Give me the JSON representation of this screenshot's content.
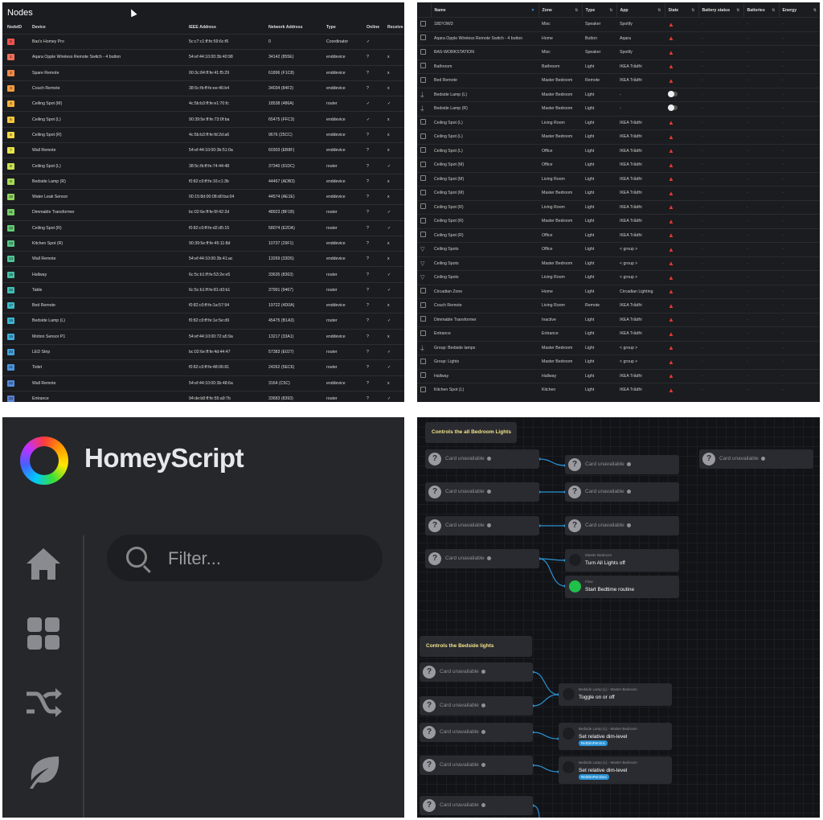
{
  "nodes": {
    "title": "Nodes",
    "headers": [
      "NodeID",
      "Device",
      "IEEE Address",
      "Network Address",
      "Type",
      "Online",
      "Receive"
    ],
    "rows": [
      {
        "id": "X",
        "color": "#ef5350",
        "device": "Bas's Homey Pro",
        "ieee": "5c:c7:c1:ff:fe:59:6c:f6",
        "net": "0",
        "type": "Coordinator",
        "online": "✓",
        "receive": ""
      },
      {
        "id": "1",
        "color": "#ef6f5a",
        "device": "Aqara Opple Wireless Remote Switch - 4 button",
        "ieee": "54:ef:44:10:00:3b:40:98",
        "net": "34142 (855E)",
        "type": "enddevice",
        "online": "?",
        "receive": "x"
      },
      {
        "id": "2",
        "color": "#f08a48",
        "device": "Spare Remote",
        "ieee": "00:3c:84:ff:fe:41:f5:29",
        "net": "61896 (F1C8)",
        "type": "enddevice",
        "online": "?",
        "receive": "x"
      },
      {
        "id": "3",
        "color": "#f39c3c",
        "device": "Couch Remote",
        "ieee": "38:5c:fb:ff:fe:ee:46:b4",
        "net": "34034 (84F2)",
        "type": "enddevice",
        "online": "?",
        "receive": "x"
      },
      {
        "id": "4",
        "color": "#f6b23a",
        "device": "Ceiling Spot (M)",
        "ieee": "4c:5b:b3:ff:fe:e1:70:fc",
        "net": "18538 (486A)",
        "type": "router",
        "online": "✓",
        "receive": "✓"
      },
      {
        "id": "5",
        "color": "#f7c73c",
        "device": "Ceiling Spot (L)",
        "ieee": "90:39:5e:ff:fe:73:0f:ba",
        "net": "65475 (FFC3)",
        "type": "enddevice",
        "online": "✓",
        "receive": "x"
      },
      {
        "id": "6",
        "color": "#f4d940",
        "device": "Ceiling Spot (R)",
        "ieee": "4c:5b:b3:ff:fe:fd:2d:a6",
        "net": "9676 (25CC)",
        "type": "enddevice",
        "online": "?",
        "receive": "x"
      },
      {
        "id": "7",
        "color": "#e8e54a",
        "device": "Wall Remote",
        "ieee": "54:ef:44:10:00:3b:51:0a",
        "net": "60303 (EB8F)",
        "type": "enddevice",
        "online": "?",
        "receive": "x"
      },
      {
        "id": "8",
        "color": "#c9e24f",
        "device": "Ceiling Spot (L)",
        "ieee": "38:5c:fb:ff:fe:74:44:48",
        "net": "37340 (91DC)",
        "type": "router",
        "online": "?",
        "receive": "✓"
      },
      {
        "id": "9",
        "color": "#a8dc55",
        "device": "Bedside Lamp (R)",
        "ieee": "f0:82:c0:ff:fe:16:c1:3b",
        "net": "44467 (ADB3)",
        "type": "enddevice",
        "online": "?",
        "receive": "x"
      },
      {
        "id": "10",
        "color": "#8fd65c",
        "device": "Water Leak Sensor",
        "ieee": "00:15:8d:00:08:d0:ba:04",
        "net": "44574 (AE1E)",
        "type": "enddevice",
        "online": "?",
        "receive": "x"
      },
      {
        "id": "11",
        "color": "#76d066",
        "device": "Dimmable Transformer",
        "ieee": "bc:02:6e:ff:fe:6f:42:2d",
        "net": "48923 (BF1B)",
        "type": "router",
        "online": "?",
        "receive": "✓"
      },
      {
        "id": "12",
        "color": "#62cb74",
        "device": "Ceiling Spot (R)",
        "ieee": "f0:82:c0:ff:fe:d2:d5:15",
        "net": "58074 (E2DA)",
        "type": "router",
        "online": "?",
        "receive": "✓"
      },
      {
        "id": "13",
        "color": "#56c786",
        "device": "Kitchen Spot (R)",
        "ieee": "90:39:5e:ff:fe:45:11:8d",
        "net": "10737 (29F1)",
        "type": "enddevice",
        "online": "?",
        "receive": "x"
      },
      {
        "id": "14",
        "color": "#4cc497",
        "device": "Wall Remote",
        "ieee": "54:ef:44:10:00:3b:41:ac",
        "net": "13269 (33D5)",
        "type": "enddevice",
        "online": "?",
        "receive": "x"
      },
      {
        "id": "15",
        "color": "#45c2a8",
        "device": "Hallway",
        "ieee": "6c:5c:b1:ff:fe:53:2e:e5",
        "net": "33635 (8363)",
        "type": "router",
        "online": "?",
        "receive": "✓"
      },
      {
        "id": "16",
        "color": "#40c0b8",
        "device": "Table",
        "ieee": "6c:5c:b1:ff:fe:81:d3:b1",
        "net": "37991 (9467)",
        "type": "router",
        "online": "?",
        "receive": "✓"
      },
      {
        "id": "17",
        "color": "#3dbdc8",
        "device": "Bed Remote",
        "ieee": "f0:82:c0:ff:fe:1a:57:94",
        "net": "19722 (4D0A)",
        "type": "enddevice",
        "online": "?",
        "receive": "x"
      },
      {
        "id": "18",
        "color": "#3cb7d4",
        "device": "Bedside Lamp (L)",
        "ieee": "f0:82:c0:ff:fe:1e:5e:d9",
        "net": "45475 (B1A3)",
        "type": "router",
        "online": "?",
        "receive": "✓"
      },
      {
        "id": "19",
        "color": "#3eaedc",
        "device": "Motion Sensor P1",
        "ieee": "54:ef:44:10:00:72:a5:9a",
        "net": "13217 (33A1)",
        "type": "enddevice",
        "online": "?",
        "receive": "x"
      },
      {
        "id": "20",
        "color": "#43a3e0",
        "device": "LED Strip",
        "ieee": "bc:02:6e:ff:fe:4d:44:47",
        "net": "57383 (E027)",
        "type": "router",
        "online": "?",
        "receive": "✓"
      },
      {
        "id": "21",
        "color": "#4a97e0",
        "device": "Toilet",
        "ieee": "f0:82:c0:ff:fe:48:06:81",
        "net": "24262 (5EC6)",
        "type": "router",
        "online": "?",
        "receive": "✓"
      },
      {
        "id": "22",
        "color": "#528bdc",
        "device": "Wall Remote",
        "ieee": "54:ef:44:10:00:3b:48:6a",
        "net": "3164 (C5C)",
        "type": "enddevice",
        "online": "?",
        "receive": "x"
      },
      {
        "id": "23",
        "color": "#5b80d6",
        "device": "Entrance",
        "ieee": "94:de:b8:ff:fe:55:a9:7b",
        "net": "33683 (8393)",
        "type": "router",
        "online": "?",
        "receive": "✓"
      }
    ]
  },
  "devices": {
    "headers": [
      "",
      "Name",
      "Zone",
      "Type",
      "App",
      "State",
      "Battery status",
      "Batteries",
      "Energy"
    ],
    "rows": [
      {
        "icon": "box",
        "name": "18DY3W3",
        "zone": "Misc",
        "type": "Speaker",
        "app": "Spotify",
        "state": "warn"
      },
      {
        "icon": "box",
        "name": "Aqara Opple Wireless Remote Switch - 4 button",
        "zone": "Home",
        "type": "Button",
        "app": "Aqara",
        "state": "warn"
      },
      {
        "icon": "box",
        "name": "BAS-WORKSTATION",
        "zone": "Misc",
        "type": "Speaker",
        "app": "Spotify",
        "state": "warn"
      },
      {
        "icon": "box",
        "name": "Bathroom",
        "zone": "Bathroom",
        "type": "Light",
        "app": "IKEA Trådfri",
        "state": "warn"
      },
      {
        "icon": "box",
        "name": "Bed Remote",
        "zone": "Master Bedroom",
        "type": "Remote",
        "app": "IKEA Trådfri",
        "state": "warn"
      },
      {
        "icon": "lamp",
        "name": "Bedside Lamp (L)",
        "zone": "Master Bedroom",
        "type": "Light",
        "app": "-",
        "state": "toggle"
      },
      {
        "icon": "lamp",
        "name": "Bedside Lamp (R)",
        "zone": "Master Bedroom",
        "type": "Light",
        "app": "-",
        "state": "toggle"
      },
      {
        "icon": "box",
        "name": "Ceiling Spot (L)",
        "zone": "Living Room",
        "type": "Light",
        "app": "IKEA Trådfri",
        "state": "warn"
      },
      {
        "icon": "box",
        "name": "Ceiling Spot (L)",
        "zone": "Master Bedroom",
        "type": "Light",
        "app": "IKEA Trådfri",
        "state": "warn"
      },
      {
        "icon": "box",
        "name": "Ceiling Spot (L)",
        "zone": "Office",
        "type": "Light",
        "app": "IKEA Trådfri",
        "state": "warn"
      },
      {
        "icon": "box",
        "name": "Ceiling Spot (M)",
        "zone": "Office",
        "type": "Light",
        "app": "IKEA Trådfri",
        "state": "warn"
      },
      {
        "icon": "box",
        "name": "Ceiling Spot (M)",
        "zone": "Living Room",
        "type": "Light",
        "app": "IKEA Trådfri",
        "state": "warn"
      },
      {
        "icon": "box",
        "name": "Ceiling Spot (M)",
        "zone": "Master Bedroom",
        "type": "Light",
        "app": "IKEA Trådfri",
        "state": "warn"
      },
      {
        "icon": "box",
        "name": "Ceiling Spot (R)",
        "zone": "Living Room",
        "type": "Light",
        "app": "IKEA Trådfri",
        "state": "warn"
      },
      {
        "icon": "box",
        "name": "Ceiling Spot (R)",
        "zone": "Master Bedroom",
        "type": "Light",
        "app": "IKEA Trådfri",
        "state": "warn"
      },
      {
        "icon": "box",
        "name": "Ceiling Spot (R)",
        "zone": "Office",
        "type": "Light",
        "app": "IKEA Trådfri",
        "state": "warn"
      },
      {
        "icon": "spot",
        "name": "Ceiling Spots",
        "zone": "Office",
        "type": "Light",
        "app": "< group >",
        "state": "warn"
      },
      {
        "icon": "spot",
        "name": "Ceiling Spots",
        "zone": "Master Bedroom",
        "type": "Light",
        "app": "< group >",
        "state": "warn"
      },
      {
        "icon": "spot",
        "name": "Ceiling Spots",
        "zone": "Living Room",
        "type": "Light",
        "app": "< group >",
        "state": "warn"
      },
      {
        "icon": "box",
        "name": "Circadian Zone",
        "zone": "Home",
        "type": "Light",
        "app": "Circadian Lighting",
        "state": "warn"
      },
      {
        "icon": "box",
        "name": "Couch Remote",
        "zone": "Living Room",
        "type": "Remote",
        "app": "IKEA Trådfri",
        "state": "warn"
      },
      {
        "icon": "box",
        "name": "Dimmable Transformer",
        "zone": "Inactive",
        "type": "Light",
        "app": "IKEA Trådfri",
        "state": "warn"
      },
      {
        "icon": "box",
        "name": "Entrance",
        "zone": "Entrance",
        "type": "Light",
        "app": "IKEA Trådfri",
        "state": "warn"
      },
      {
        "icon": "lamp",
        "name": "Group: Bedside lamps",
        "zone": "Master Bedroom",
        "type": "Light",
        "app": "< group >",
        "state": "warn"
      },
      {
        "icon": "box",
        "name": "Group: Lights",
        "zone": "Master Bedroom",
        "type": "Light",
        "app": "< group >",
        "state": "warn"
      },
      {
        "icon": "box",
        "name": "Hallway",
        "zone": "Hallway",
        "type": "Light",
        "app": "IKEA Trådfri",
        "state": "warn"
      },
      {
        "icon": "box",
        "name": "Kitchen Spot (L)",
        "zone": "Kitchen",
        "type": "Light",
        "app": "IKEA Trådfri",
        "state": "warn"
      }
    ],
    "dash": "-"
  },
  "homeyscript": {
    "title": "HomeyScript",
    "filter_placeholder": "Filter..."
  },
  "flow": {
    "note1": "Controls the all Bedroom Lights",
    "note2": "Controls the Bedside lights",
    "unavailable": "Card unavailable",
    "action1_sub": "Master Bedroom",
    "action1_main": "Turn All Lights off",
    "action2_sub": "Flow",
    "action2_main": "Start Bedtime routine",
    "action3_sub": "Bedside Lamp (L) - Master Bedroom",
    "action3_main": "Toggle on or off",
    "action4_sub": "Bedside Lamp (L) - Master Bedroom",
    "action4_main": "Set relative dim-level",
    "action4_tag": "RelDimPercInc",
    "action5_sub": "Bedside Lamp (L) - Master Bedroom",
    "action5_main": "Set relative dim-level",
    "action5_tag": "RelDimPercDec"
  }
}
